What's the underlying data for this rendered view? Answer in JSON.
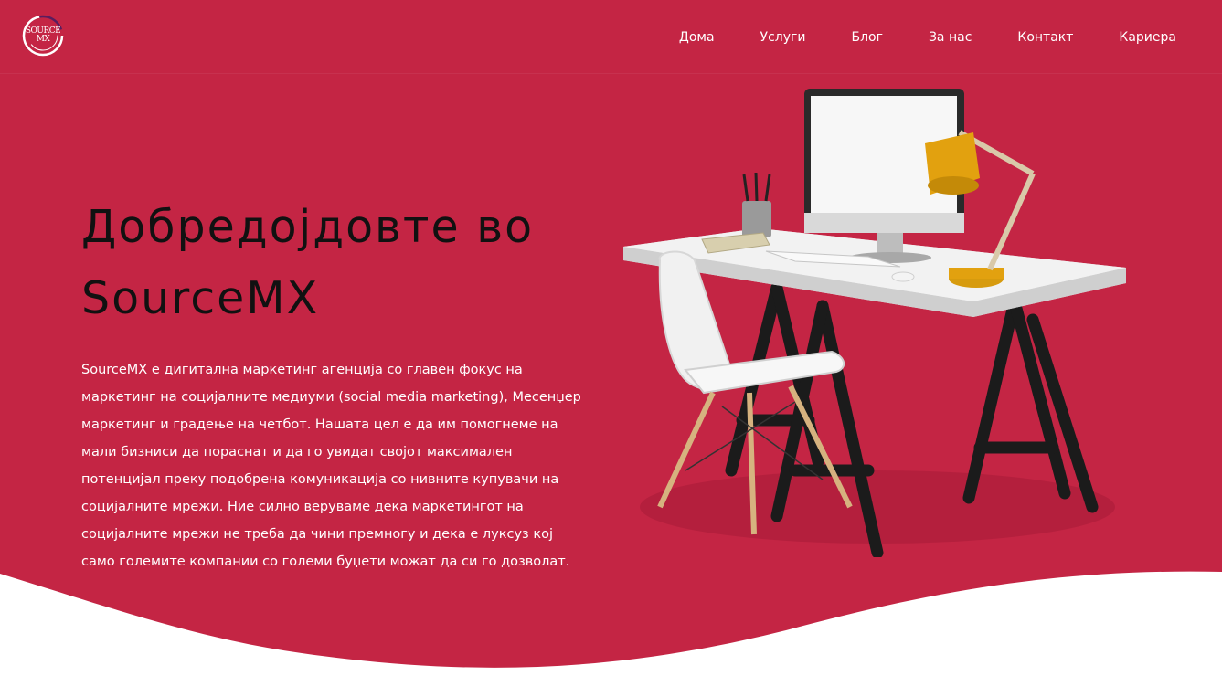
{
  "colors": {
    "brand_red": "#C42544",
    "wave_white": "#FFFFFF",
    "title_text": "#111111",
    "body_text": "#FFFFFF",
    "lamp_yellow": "#E2A10F"
  },
  "header": {
    "logo_text": "SOURCE MX",
    "nav": [
      {
        "label": "Дома"
      },
      {
        "label": "Услуги"
      },
      {
        "label": "Блог"
      },
      {
        "label": "За нас"
      },
      {
        "label": "Контакт"
      },
      {
        "label": "Кариера"
      }
    ]
  },
  "hero": {
    "title_line1": "Добредојдовте во",
    "title_line2": "SourceMX",
    "description": "SourceMX е дигитална маркетинг агенција со главен фокус на маркетинг на социјалните медиуми (social media marketing), Месенџер маркетинг и градење на четбот. Нашата цел е да им помогнеме на мали бизниси да пораснат и да го увидат својот максимален потенцијал преку подобрена комуникација со нивните купувачи на социјалните мрежи. Ние силно веруваме дека маркетингот на социјалните мрежи не треба да чини премногу и дека е луксуз кој само големите компании со големи буџети можат да си го дозволат.",
    "illustration": "desk-with-computer-lamp-chair-illustration"
  }
}
